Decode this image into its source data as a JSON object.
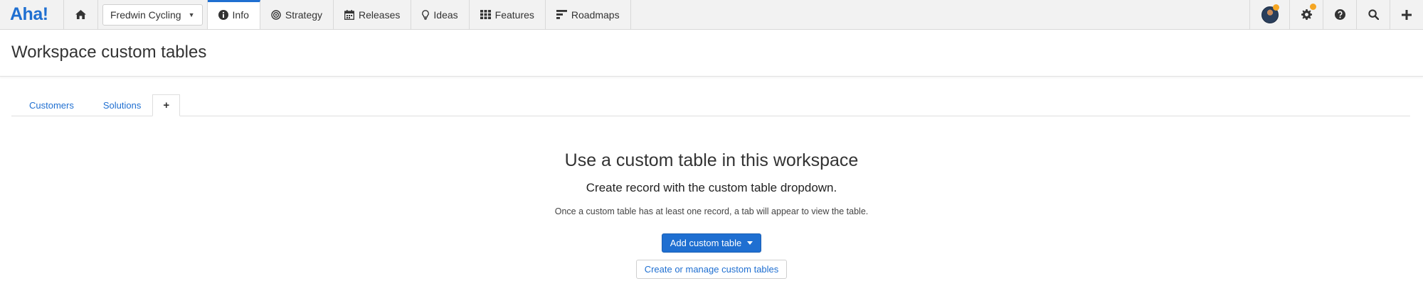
{
  "app": {
    "logo_text": "Aha!",
    "brand_color": "#1f6fd1",
    "badge_color": "#f5a623"
  },
  "nav": {
    "home_icon": "home-icon",
    "workspace": "Fredwin Cycling",
    "tabs": [
      {
        "label": "Info",
        "icon": "info-icon",
        "active": true
      },
      {
        "label": "Strategy",
        "icon": "target-icon"
      },
      {
        "label": "Releases",
        "icon": "calendar-icon"
      },
      {
        "label": "Ideas",
        "icon": "lightbulb-icon"
      },
      {
        "label": "Features",
        "icon": "grid-icon"
      },
      {
        "label": "Roadmaps",
        "icon": "roadmap-icon"
      }
    ],
    "right_icons": [
      "avatar",
      "gear-icon",
      "help-icon",
      "search-icon",
      "plus-icon"
    ]
  },
  "page": {
    "title": "Workspace custom tables"
  },
  "subtabs": [
    {
      "label": "Customers"
    },
    {
      "label": "Solutions"
    },
    {
      "label": "+"
    }
  ],
  "empty_state": {
    "title": "Use a custom table in this workspace",
    "subtitle": "Create record with the custom table dropdown.",
    "description": "Once a custom table has at least one record, a tab will appear to view the table.",
    "primary_button": "Add custom table",
    "secondary_button": "Create or manage custom tables"
  }
}
